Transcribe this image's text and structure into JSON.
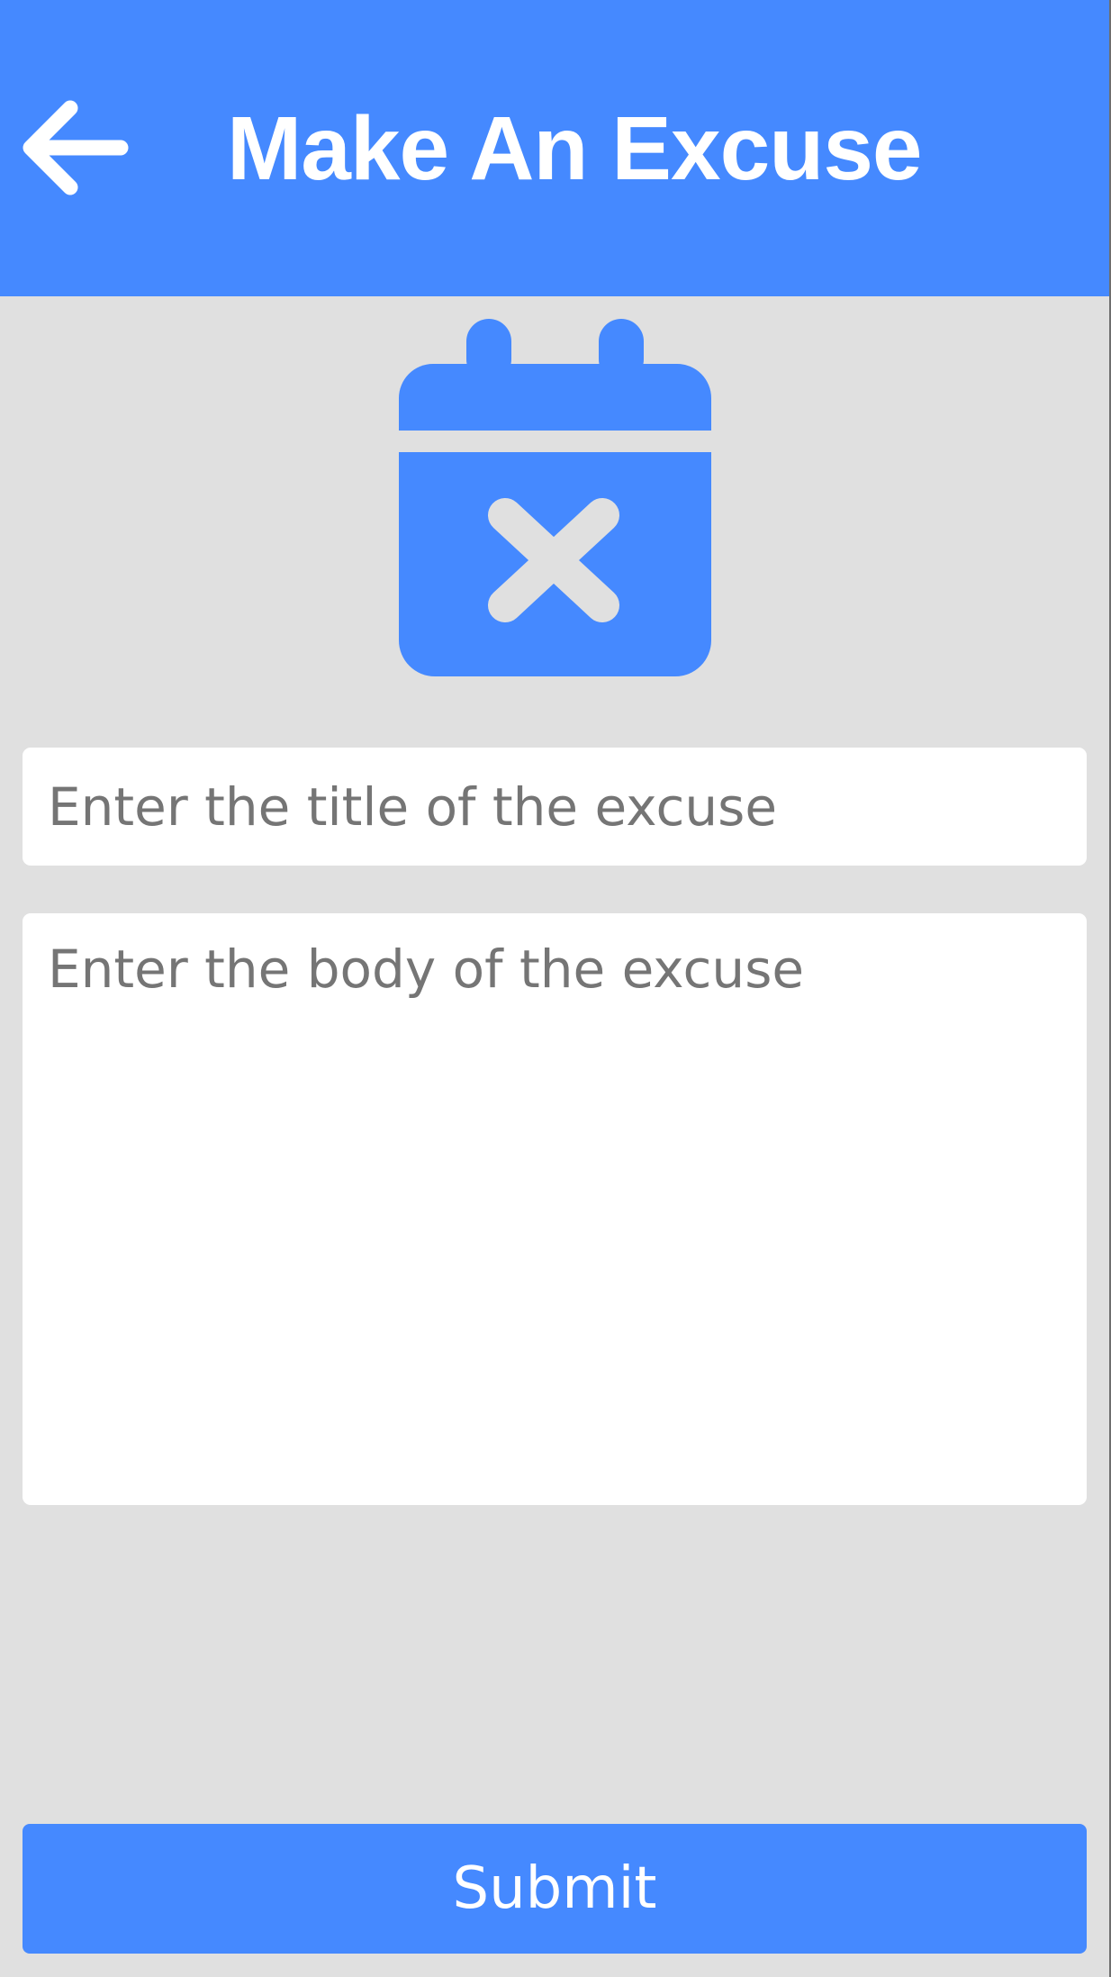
{
  "app_bar": {
    "title": "Make An Excuse",
    "back_icon": "arrow-left-icon",
    "background_color": "#4589FF",
    "title_color": "#FFFFFF"
  },
  "hero": {
    "icon": "calendar-remove-icon",
    "color": "#4589FF"
  },
  "form": {
    "title_field": {
      "placeholder": "Enter the title of the excuse",
      "value": ""
    },
    "body_field": {
      "placeholder": "Enter the body of the excuse",
      "value": ""
    },
    "submit_label": "Submit"
  },
  "colors": {
    "accent": "#4589FF",
    "background": "#E0E0E0",
    "field_background": "#FFFFFF",
    "placeholder_text": "#757575"
  }
}
